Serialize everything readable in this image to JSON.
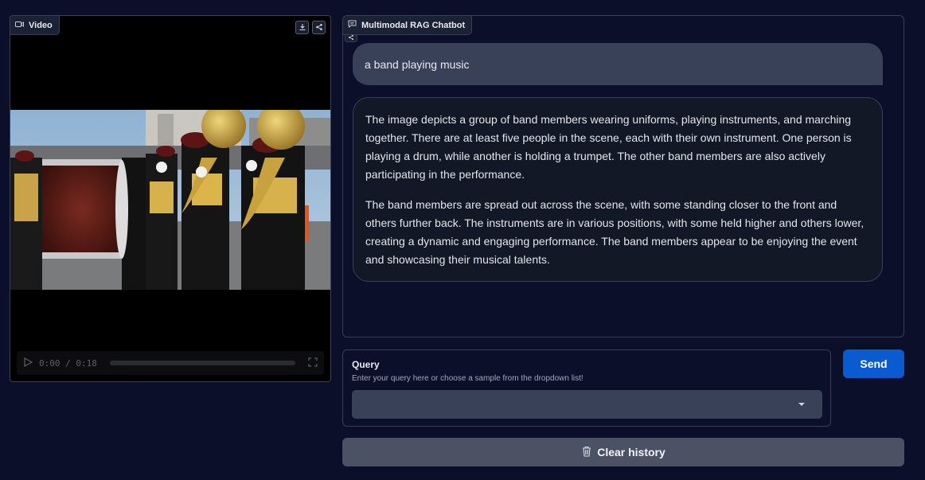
{
  "video_panel": {
    "label": "Video",
    "label_icon": "video-camera-icon",
    "actions": [
      "download-icon",
      "share-icon"
    ],
    "time_display": "0:00 / 0:18"
  },
  "chat_panel": {
    "label": "Multimodal RAG Chatbot",
    "label_icon": "chat-bubble-icon",
    "messages": [
      {
        "role": "user",
        "text": "a band playing music"
      },
      {
        "role": "bot",
        "paragraphs": [
          "The image depicts a group of band members wearing uniforms, playing instruments, and marching together. There are at least five people in the scene, each with their own instrument. One person is playing a drum, while another is holding a trumpet. The other band members are also actively participating in the performance.",
          "The band members are spread out across the scene, with some standing closer to the front and others further back. The instruments are in various positions, with some held higher and others lower, creating a dynamic and engaging performance. The band members appear to be enjoying the event and showcasing their musical talents."
        ]
      }
    ]
  },
  "query": {
    "label": "Query",
    "info": "Enter your query here or choose a sample from the dropdown list!",
    "selected_value": ""
  },
  "send_button": {
    "label": "Send"
  },
  "clear_button": {
    "label": "Clear history",
    "icon": "trash-icon"
  },
  "colors": {
    "background": "#0b0f2a",
    "primary": "#0b5bd0",
    "secondary": "#4b5263",
    "user_bubble": "#384158",
    "bot_bubble": "#121826"
  }
}
